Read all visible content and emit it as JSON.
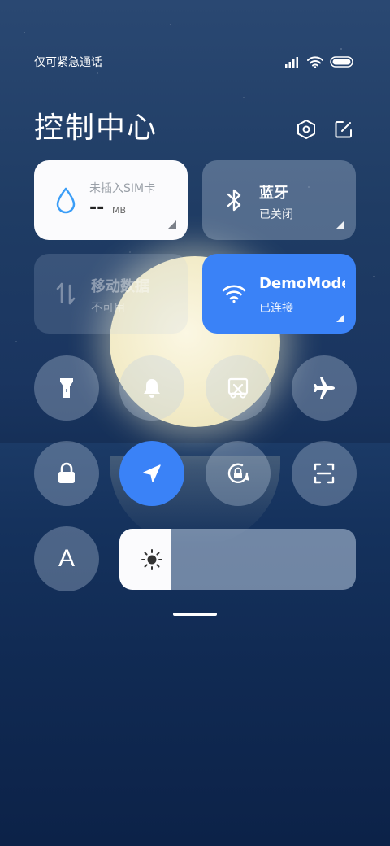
{
  "status_bar": {
    "carrier_text": "仅可紧急通话",
    "icons": [
      "signal-icon",
      "wifi-icon",
      "battery-icon"
    ]
  },
  "header": {
    "title": "控制中心",
    "settings_icon": "settings-hexagon-icon",
    "edit_icon": "edit-icon"
  },
  "tiles": {
    "data_usage": {
      "label": "未插入SIM卡",
      "value": "--",
      "unit": "MB",
      "icon": "water-drop-icon",
      "accent": "#3a9df7"
    },
    "bluetooth": {
      "title": "蓝牙",
      "subtitle": "已关闭",
      "icon": "bluetooth-icon"
    },
    "mobile_data": {
      "title": "移动数据",
      "subtitle": "不可用",
      "icon": "mobile-data-icon"
    },
    "wifi": {
      "title": "DemoMode",
      "subtitle": "已连接",
      "icon": "wifi-icon",
      "accent": "#3a82f7"
    }
  },
  "toggles_row1": [
    "flashlight-icon",
    "bell-icon",
    "screenshot-icon",
    "airplane-icon"
  ],
  "toggles_row2": [
    "lock-icon",
    "location-icon",
    "rotation-lock-icon",
    "scanner-icon"
  ],
  "font_toggle": {
    "label": "A",
    "icon": "font-size-icon"
  },
  "brightness": {
    "level": 0.22,
    "icon": "sun-icon"
  },
  "colors": {
    "active_blue": "#3a82f7",
    "tile_white": "#fbfbfd"
  }
}
